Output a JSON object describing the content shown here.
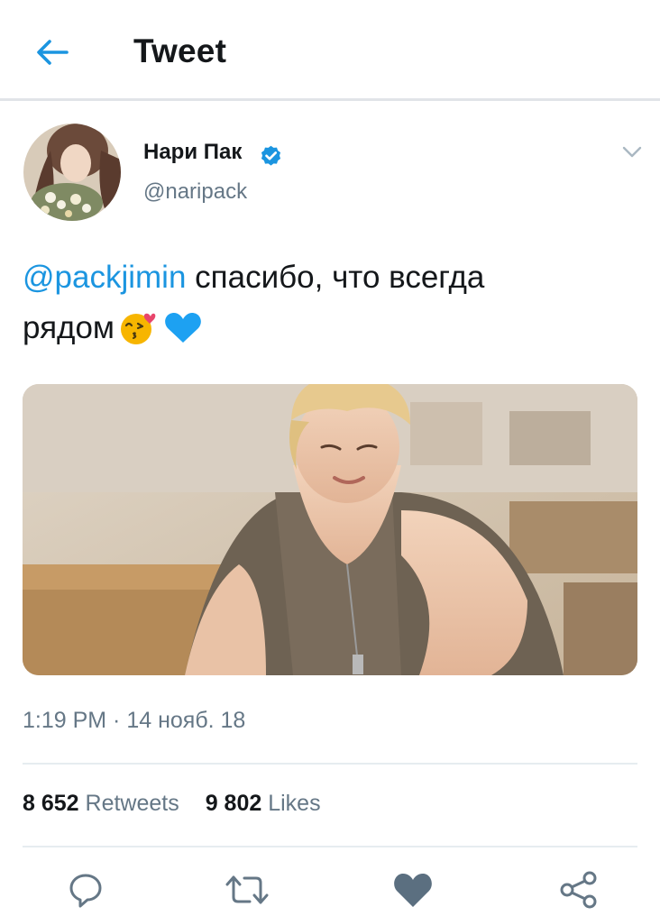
{
  "header": {
    "title": "Tweet",
    "back_icon": "arrow-left-icon",
    "accent": "#1b95e0"
  },
  "tweet": {
    "author_name": "Нари Пак",
    "handle": "@naripack",
    "verified_icon": "verified-badge-icon",
    "menu_icon": "chevron-down-icon",
    "mention": "@packjimin",
    "text_line1": " спасибо, что всегда",
    "text_line2": "рядом",
    "emojis": [
      "kissing-face-heart-emoji",
      "blue-heart-emoji"
    ],
    "timestamp": "1:19 PM · 14 нояб. 18"
  },
  "stats": {
    "retweets_count": "8 652",
    "retweets_label": "Retweets",
    "likes_count": "9 802",
    "likes_label": "Likes"
  },
  "actions": {
    "icons": [
      "reply-icon",
      "retweet-icon",
      "like-icon",
      "share-icon"
    ],
    "icon_color": "#657786",
    "like_color": "#5b6f80"
  }
}
